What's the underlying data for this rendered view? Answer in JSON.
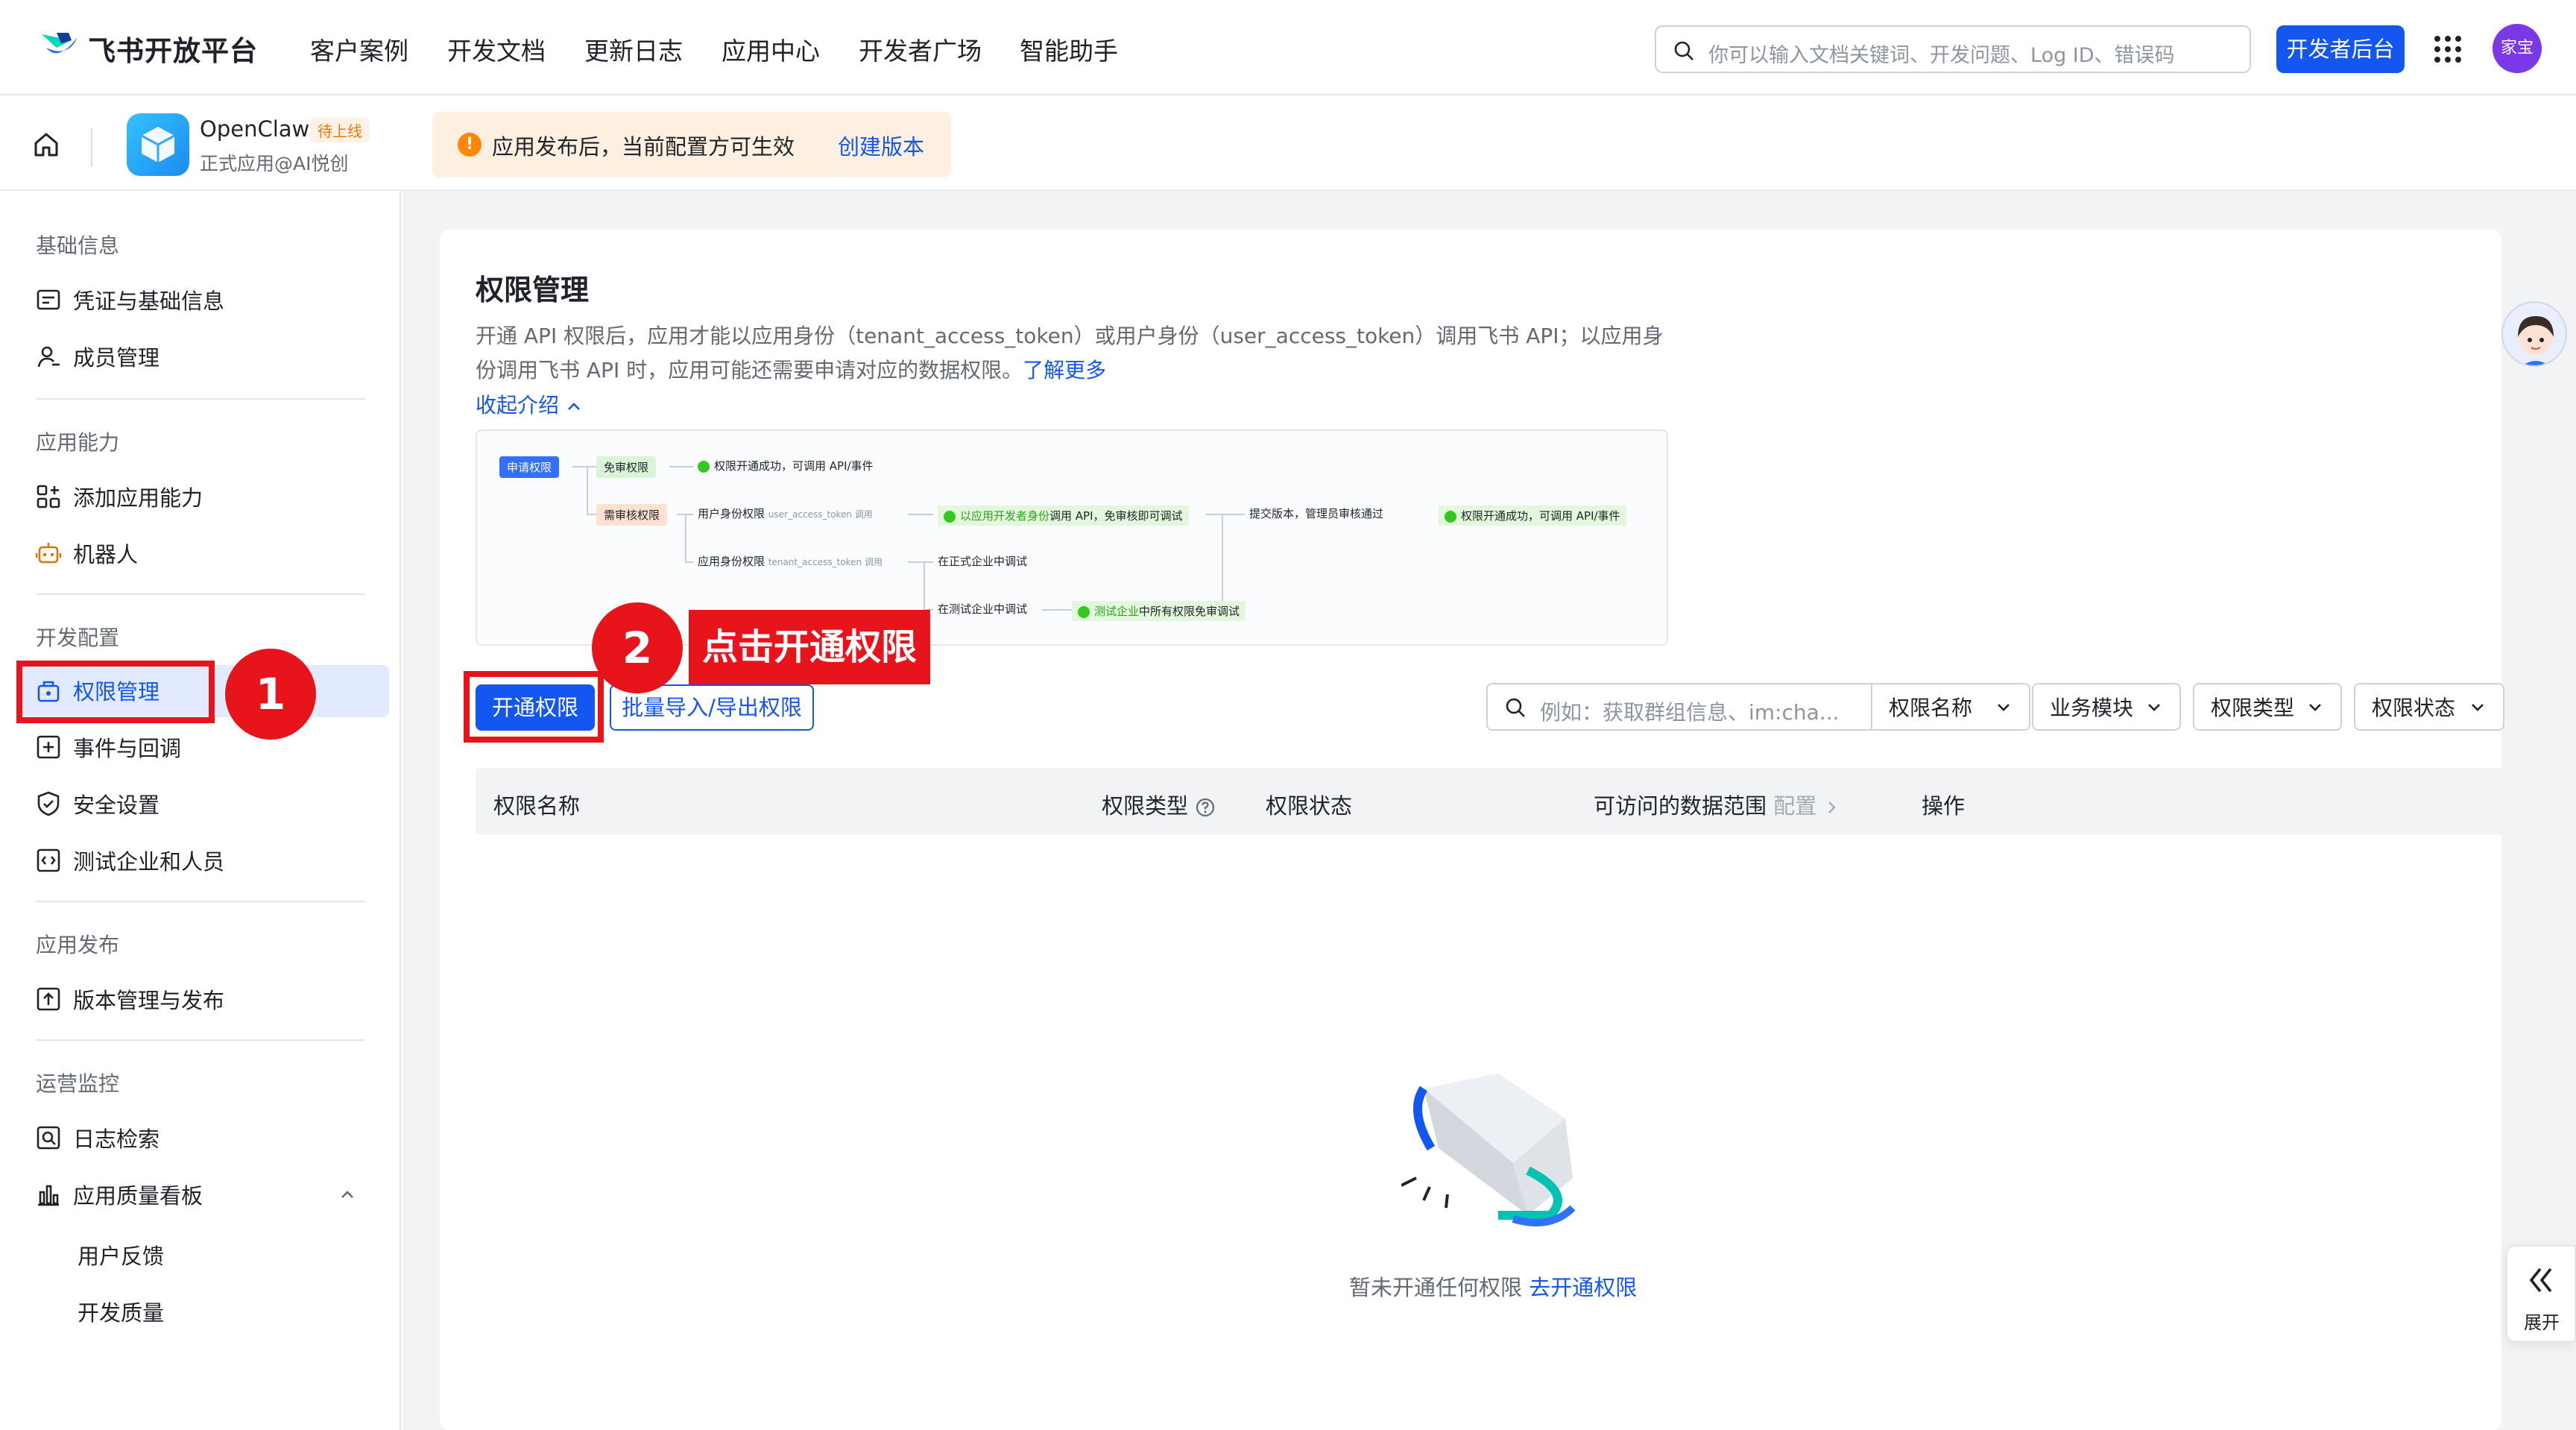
{
  "topnav": {
    "brand": "飞书开放平台",
    "items": [
      "客户案例",
      "开发文档",
      "更新日志",
      "应用中心",
      "开发者广场",
      "智能助手"
    ],
    "search_placeholder": "你可以输入文档关键词、开发问题、Log ID、错误码",
    "console_button": "开发者后台",
    "avatar_text": "家宝"
  },
  "appbar": {
    "app_name": "OpenClaw",
    "app_badge": "待上线",
    "app_sub": "正式应用@AI悦创",
    "notice": "应用发布后，当前配置方可生效",
    "notice_link": "创建版本"
  },
  "sidebar": {
    "sections": [
      {
        "title": "基础信息",
        "items": [
          "凭证与基础信息",
          "成员管理"
        ]
      },
      {
        "title": "应用能力",
        "items": [
          "添加应用能力",
          "机器人"
        ]
      },
      {
        "title": "开发配置",
        "items": [
          "权限管理",
          "事件与回调",
          "安全设置",
          "测试企业和人员"
        ]
      },
      {
        "title": "应用发布",
        "items": [
          "版本管理与发布"
        ]
      },
      {
        "title": "运营监控",
        "items": [
          "日志检索",
          "应用质量看板"
        ]
      }
    ],
    "sub_items": [
      "用户反馈",
      "开发质量"
    ]
  },
  "main": {
    "title": "权限管理",
    "desc": "开通 API 权限后，应用才能以应用身份（tenant_access_token）或用户身份（user_access_token）调用飞书 API；以应用身份调用飞书 API 时，应用可能还需要申请对应的数据权限。",
    "desc_link": "了解更多",
    "collapse": "收起介绍",
    "flow": {
      "apply": "申请权限",
      "free": "免审权限",
      "free_result": "权限开通成功，可调用 API/事件",
      "review": "需审核权限",
      "user_identity": "用户身份权限",
      "user_token": "user_access_token 调用",
      "dev_debug_a": "以应用开发者身份",
      "dev_debug_b": "调用 API，免审核即可调试",
      "submit": "提交版本，管理员审核通过",
      "final_result": "权限开通成功，可调用 API/事件",
      "app_identity": "应用身份权限",
      "tenant_token": "tenant_access_token 调用",
      "prod_debug": "在正式企业中调试",
      "test_debug": "在测试企业中调试",
      "test_free_a": "测试企业",
      "test_free_b": "中所有权限免审调试"
    },
    "btn_open": "开通权限",
    "btn_batch": "批量导入/导出权限",
    "filter_placeholder": "例如：获取群组信息、im:cha...",
    "filters": [
      "权限名称",
      "业务模块",
      "权限类型",
      "权限状态"
    ],
    "columns": [
      "权限名称",
      "权限类型",
      "权限状态",
      "可访问的数据范围",
      "配置",
      "操作"
    ],
    "empty_text": "暂未开通任何权限",
    "empty_link": "去开通权限",
    "expand": "展开"
  },
  "annotations": {
    "step1": "1",
    "step2": "2",
    "step2_label": "点击开通权限"
  },
  "colors": {
    "primary": "#1456f0",
    "annotation": "#e8141c",
    "warning": "#ff8800"
  }
}
